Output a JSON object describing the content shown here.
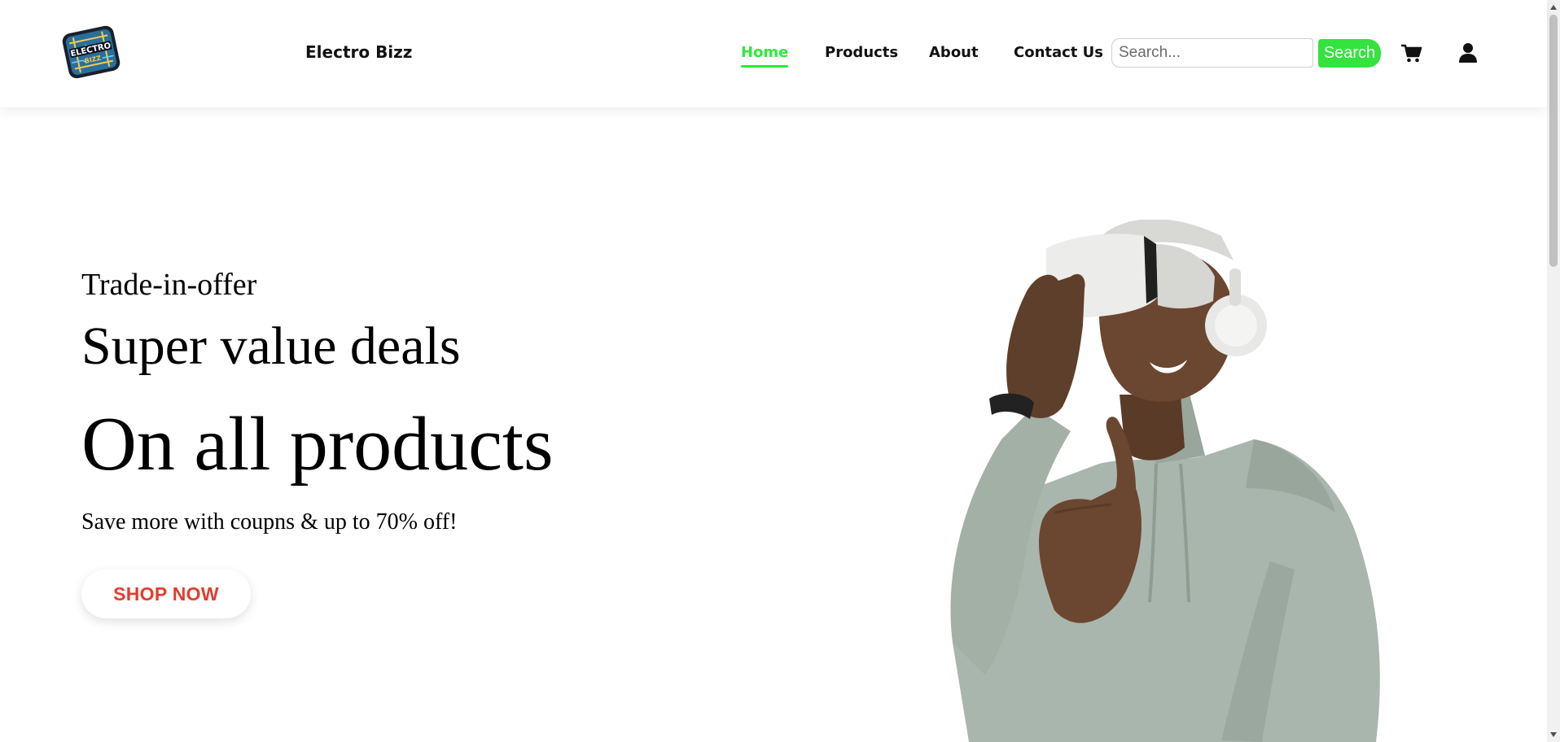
{
  "header": {
    "brand_name": "Electro Bizz",
    "logo_text_line1": "ELECTRO",
    "logo_text_line2": "BIZZ",
    "nav": [
      {
        "label": "Home",
        "active": true
      },
      {
        "label": "Products",
        "active": false
      },
      {
        "label": "About",
        "active": false
      },
      {
        "label": "Contact Us",
        "active": false
      }
    ],
    "search": {
      "placeholder": "Search...",
      "value": "",
      "button_label": "Search"
    },
    "icons": {
      "cart": "cart-icon",
      "user": "user-icon"
    }
  },
  "hero": {
    "kicker": "Trade-in-offer",
    "headline": "Super value deals",
    "headline_large": "On all products",
    "subtext": "Save more with coupns & up to 70% off!",
    "cta_label": "SHOP NOW"
  },
  "colors": {
    "accent_green": "#2ee93a",
    "cta_red": "#e13d2e",
    "hoodie": "#a9b6ad",
    "headset": "#ececea"
  }
}
